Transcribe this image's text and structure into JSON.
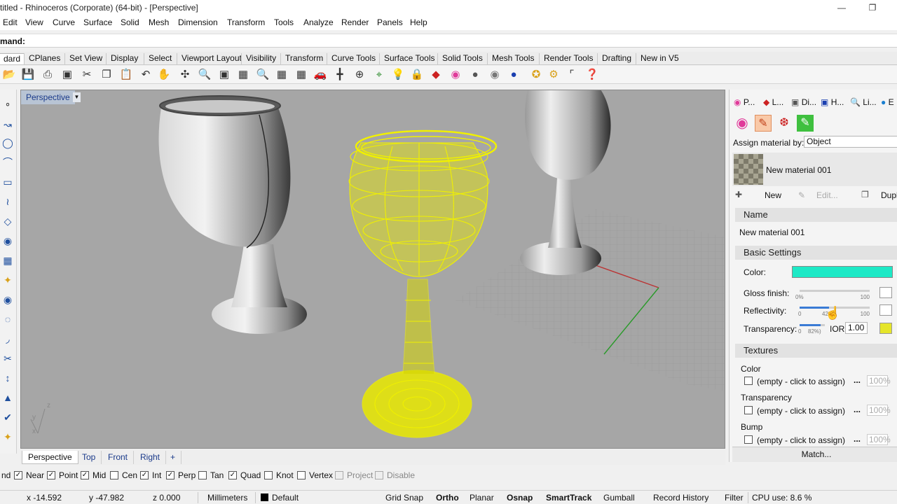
{
  "window": {
    "title": "titled - Rhinoceros (Corporate) (64-bit) - [Perspective]"
  },
  "menu": [
    "Edit",
    "View",
    "Curve",
    "Surface",
    "Solid",
    "Mesh",
    "Dimension",
    "Transform",
    "Tools",
    "Analyze",
    "Render",
    "Panels",
    "Help"
  ],
  "command": {
    "label": "mand:"
  },
  "toolbar_tabs": [
    "dard",
    "CPlanes",
    "Set View",
    "Display",
    "Select",
    "Viewport Layout",
    "Visibility",
    "Transform",
    "Curve Tools",
    "Surface Tools",
    "Solid Tools",
    "Mesh Tools",
    "Render Tools",
    "Drafting",
    "New in V5"
  ],
  "viewport": {
    "title": "Perspective",
    "dropdown_glyph": "▼",
    "axes": {
      "x": "x",
      "y": "y",
      "z": "z"
    }
  },
  "viewport_tabs": [
    "Perspective",
    "Top",
    "Front",
    "Right",
    "+"
  ],
  "osnaps": [
    {
      "label": "nd",
      "checked": true,
      "enabled": true
    },
    {
      "label": "Near",
      "checked": true,
      "enabled": true
    },
    {
      "label": "Point",
      "checked": true,
      "enabled": true
    },
    {
      "label": "Mid",
      "checked": true,
      "enabled": true
    },
    {
      "label": "Cen",
      "checked": false,
      "enabled": true
    },
    {
      "label": "Int",
      "checked": true,
      "enabled": true
    },
    {
      "label": "Perp",
      "checked": true,
      "enabled": true
    },
    {
      "label": "Tan",
      "checked": false,
      "enabled": true
    },
    {
      "label": "Quad",
      "checked": true,
      "enabled": true
    },
    {
      "label": "Knot",
      "checked": false,
      "enabled": true
    },
    {
      "label": "Vertex",
      "checked": false,
      "enabled": true
    },
    {
      "label": "Project",
      "checked": false,
      "enabled": false
    },
    {
      "label": "Disable",
      "checked": false,
      "enabled": false
    }
  ],
  "status": {
    "x": "x -14.592",
    "y": "y -47.982",
    "z": "z 0.000",
    "units": "Millimeters",
    "layer": "Default",
    "grid_snap": "Grid Snap",
    "ortho": "Ortho",
    "planar": "Planar",
    "osnap": "Osnap",
    "smarttrack": "SmartTrack",
    "gumball": "Gumball",
    "record_history": "Record History",
    "filter": "Filter",
    "cpu": "CPU use: 8.6 %"
  },
  "panel": {
    "tabs": [
      "P...",
      "L...",
      "Di...",
      "H...",
      "Li...",
      "E"
    ],
    "assign_label": "Assign material by:",
    "assign_value": "Object",
    "material_name": "New material 001",
    "actions": {
      "new": "New",
      "edit": "Edit...",
      "duplicate": "Dupli"
    },
    "name_header": "Name",
    "name_value": "New material 001",
    "basic_header": "Basic Settings",
    "color_label": "Color:",
    "color_value": "#1de9c6",
    "gloss_label": "Gloss finish:",
    "gloss_pct": "0%",
    "gloss_max": "100",
    "gloss_level": 0.0,
    "reflect_label": "Reflectivity:",
    "reflect_min": "0",
    "reflect_max": "100",
    "reflect_mid": "42",
    "reflect_level": 0.42,
    "transp_label": "Transparency:",
    "transp_min": "0",
    "transp_pct": "82%)",
    "transp_level": 0.82,
    "ior_label": "IOR:",
    "ior_value": "1.00",
    "textures_header": "Textures",
    "tex": [
      {
        "title": "Color",
        "slot": "(empty - click to assign)",
        "dots": "...",
        "pct": "100%"
      },
      {
        "title": "Transparency",
        "slot": "(empty - click to assign)",
        "dots": "...",
        "pct": "100%"
      },
      {
        "title": "Bump",
        "slot": "(empty - click to assign)",
        "dots": "...",
        "pct": "100%"
      }
    ],
    "match": "Match..."
  },
  "colors": {
    "accent": "#1de9c6",
    "transparency_swatch": "#e5e52a",
    "selection": "#ffff00"
  }
}
